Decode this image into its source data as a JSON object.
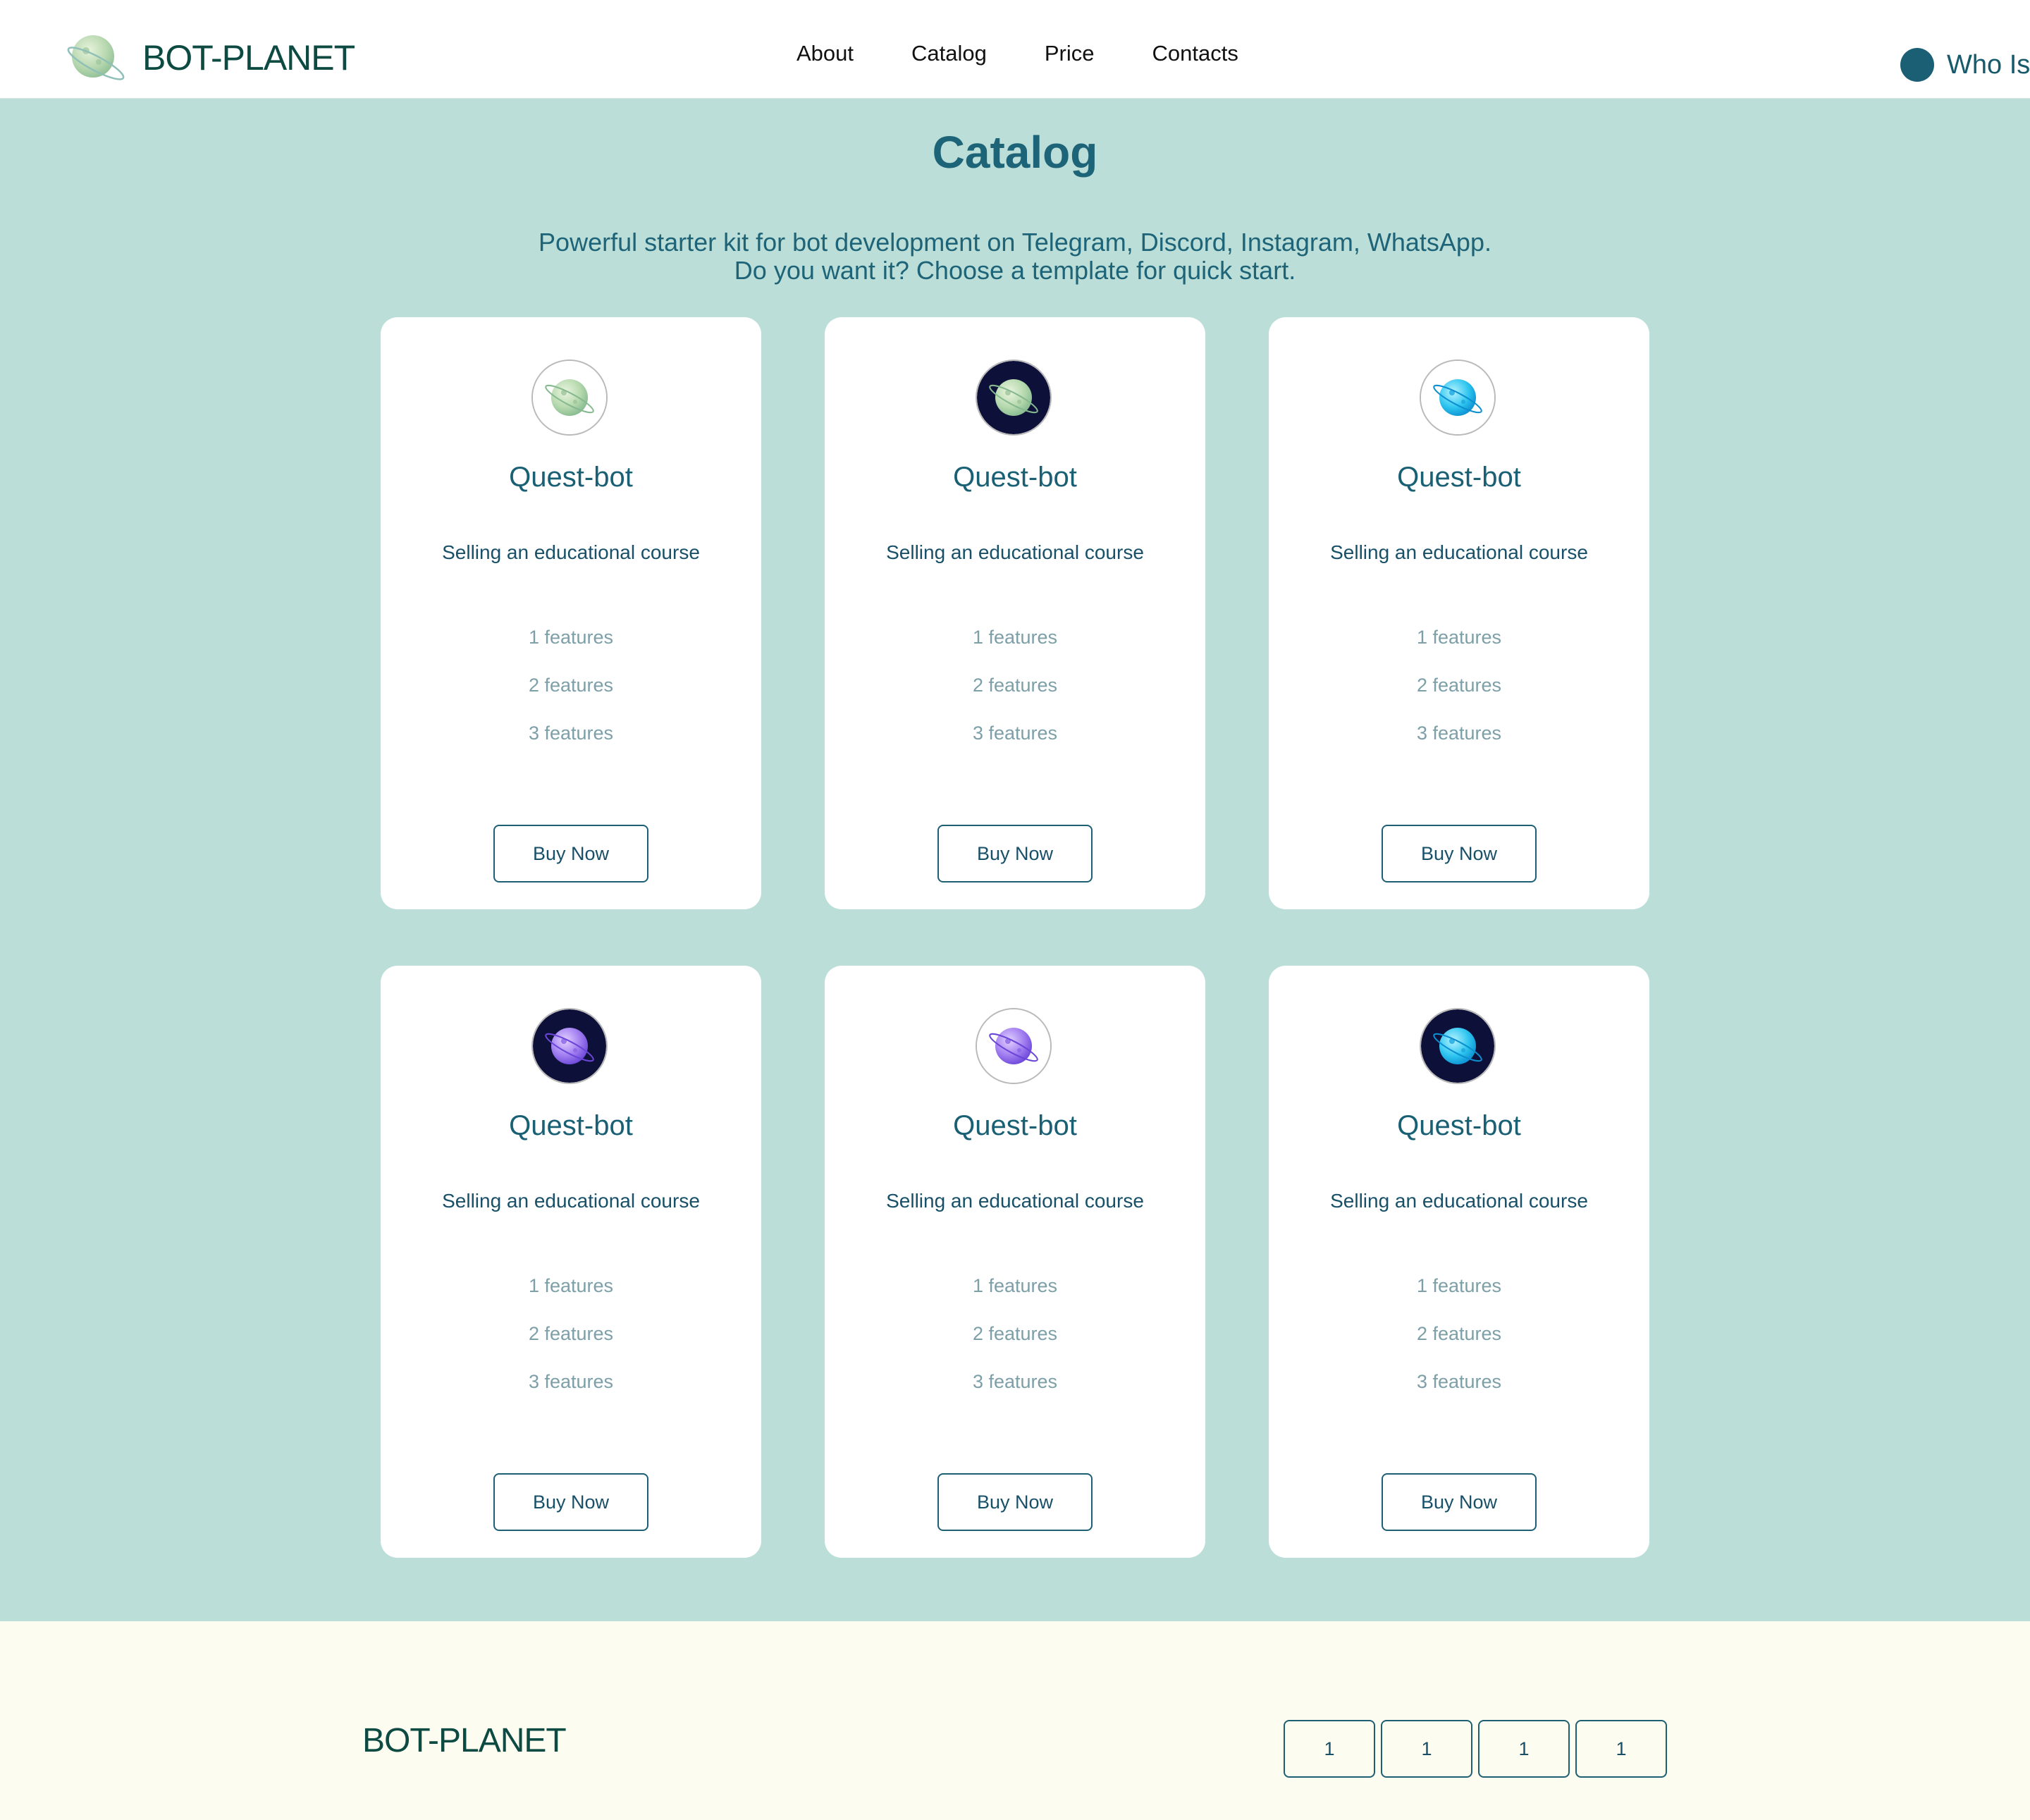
{
  "header": {
    "logo_text": "BOT-PLANET",
    "nav": [
      "About",
      "Catalog",
      "Price",
      "Contacts"
    ],
    "who_label": "Who Is"
  },
  "catalog": {
    "title": "Catalog",
    "subtitle_line1": "Powerful starter kit for bot development on Telegram, Discord, Instagram, WhatsApp.",
    "subtitle_line2": "Do you want it? Choose a template for quick start.",
    "cards": [
      {
        "title": "Quest-bot",
        "description": "Selling an educational course",
        "features": [
          "1 features",
          "2 features",
          "3 features"
        ],
        "button": "Buy Now",
        "icon": "green-planet-icon"
      },
      {
        "title": "Quest-bot",
        "description": "Selling an educational course",
        "features": [
          "1 features",
          "2 features",
          "3 features"
        ],
        "button": "Buy Now",
        "icon": "green-planet-dark-icon"
      },
      {
        "title": "Quest-bot",
        "description": "Selling an educational course",
        "features": [
          "1 features",
          "2 features",
          "3 features"
        ],
        "button": "Buy Now",
        "icon": "blue-planet-icon"
      },
      {
        "title": "Quest-bot",
        "description": "Selling an educational course",
        "features": [
          "1 features",
          "2 features",
          "3 features"
        ],
        "button": "Buy Now",
        "icon": "purple-planet-dark-icon"
      },
      {
        "title": "Quest-bot",
        "description": "Selling an educational course",
        "features": [
          "1 features",
          "2 features",
          "3 features"
        ],
        "button": "Buy Now",
        "icon": "purple-planet-icon"
      },
      {
        "title": "Quest-bot",
        "description": "Selling an educational course",
        "features": [
          "1 features",
          "2 features",
          "3 features"
        ],
        "button": "Buy Now",
        "icon": "blue-planet-dark-icon"
      }
    ]
  },
  "footer": {
    "logo_text": "BOT-PLANET",
    "buttons": [
      "1",
      "1",
      "1",
      "1"
    ]
  },
  "colors": {
    "header_bg": "#ffffff",
    "catalog_bg": "#bcded8",
    "footer_bg": "#fdfcf0",
    "accent": "#1d5f73",
    "brand_text": "#0d4a42"
  }
}
